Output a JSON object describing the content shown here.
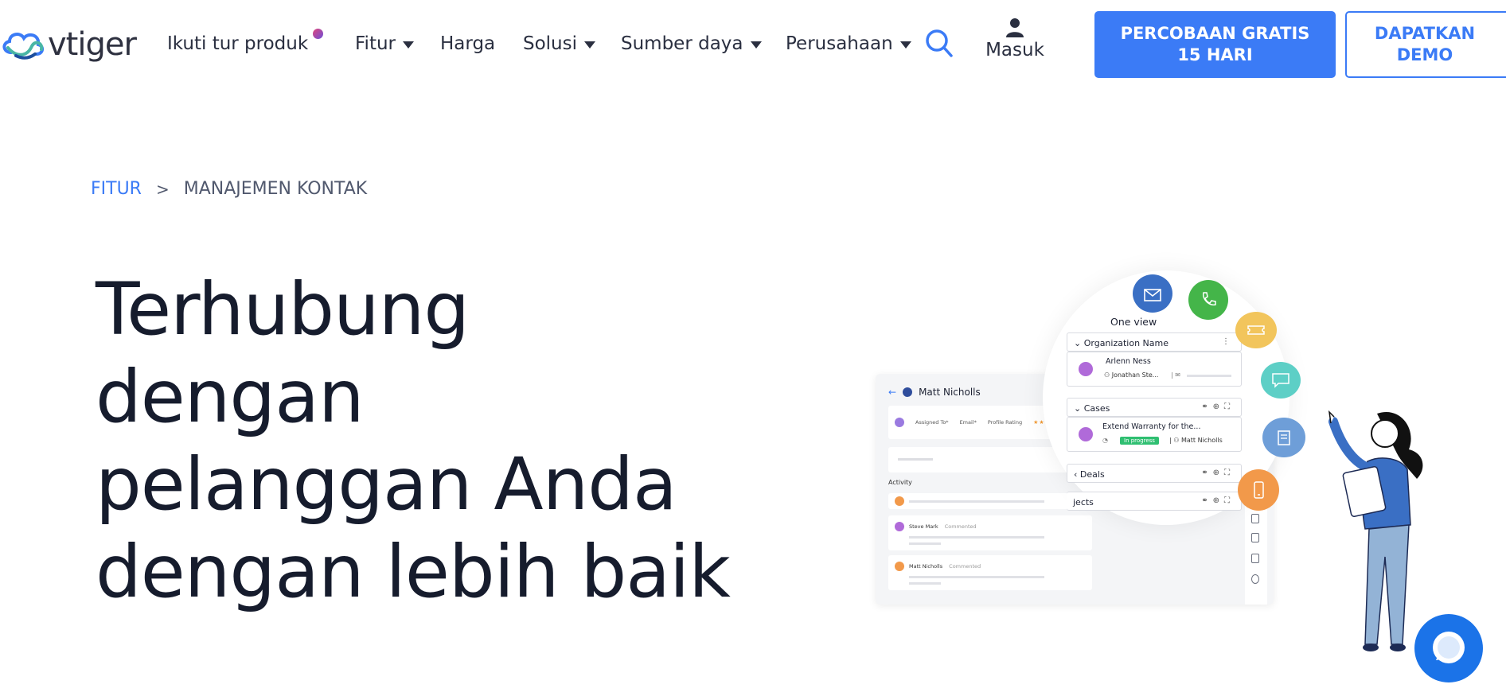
{
  "header": {
    "logo_text": "vtiger",
    "tour_label": "Ikuti tur produk",
    "nav": [
      {
        "label": "Fitur",
        "dropdown": true
      },
      {
        "label": "Harga",
        "dropdown": false
      },
      {
        "label": "Solusi",
        "dropdown": true
      },
      {
        "label": "Sumber daya",
        "dropdown": true
      },
      {
        "label": "Perusahaan",
        "dropdown": true
      }
    ],
    "search_icon": "search-icon",
    "login_label": "Masuk",
    "trial_button": "PERCOBAAN GRATIS 15 HARI",
    "demo_button": "DAPATKAN DEMO"
  },
  "breadcrumb": {
    "parent": "FITUR",
    "separator": ">",
    "current": "MANAJEMEN KONTAK"
  },
  "hero": {
    "title": "Terhubung dengan pelanggan Anda dengan lebih baik"
  },
  "illustration": {
    "contact_name": "Matt Nicholls",
    "fields": [
      "Assigned To*",
      "Email*",
      "Profile Rating"
    ],
    "rating_stars": "★★★★",
    "activity_label": "Activity",
    "activity_rows": [
      {
        "who": "Steve Mark",
        "action": "Commented"
      },
      {
        "who": "Matt Nicholls",
        "action": "Commented"
      }
    ],
    "one_view_title": "One view",
    "org_header": "Organization Name",
    "org_name": "Arlenn Ness",
    "org_contact": "Jonathan Ste...",
    "cases_header": "Cases",
    "case_title": "Extend Warranty for the...",
    "case_status": "In progress",
    "case_owner": "Matt Nicholls",
    "deals_header": "Deals",
    "projects_header": "jects"
  },
  "colors": {
    "brand_blue": "#3b7bf6",
    "text_dark": "#161c2d",
    "bubble_envelope": "#3a6fc4",
    "bubble_phone": "#44b549",
    "bubble_ticket": "#f2c55c",
    "bubble_chat": "#5dcfc6",
    "bubble_notes": "#6e9ed8",
    "bubble_mobile": "#f2994a"
  }
}
